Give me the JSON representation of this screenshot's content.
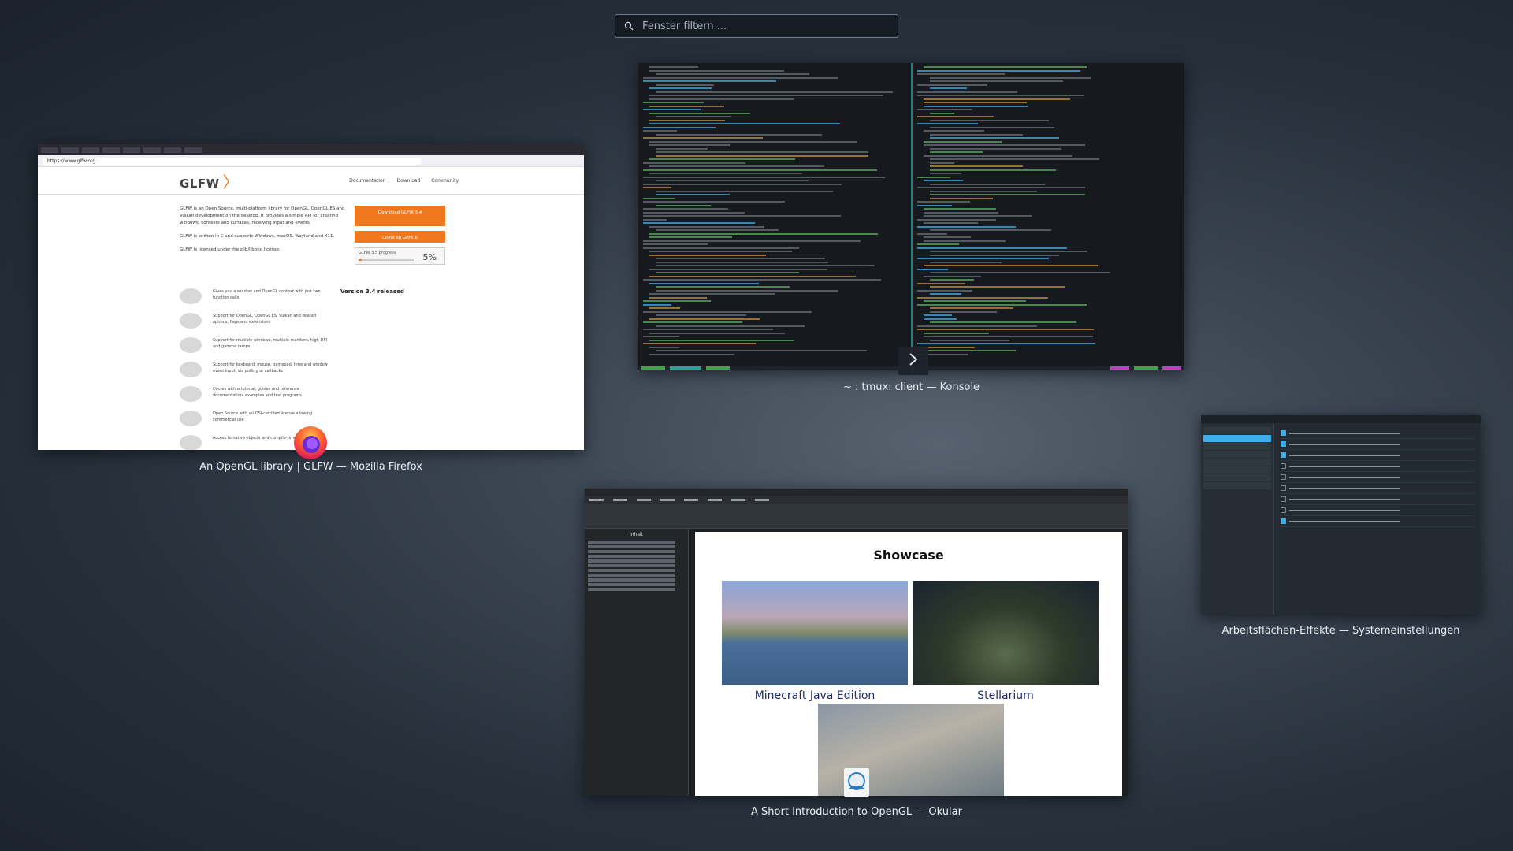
{
  "search": {
    "placeholder": "Fenster filtern ..."
  },
  "windows": {
    "firefox": {
      "caption": "An OpenGL library | GLFW — Mozilla Firefox",
      "page": {
        "url": "https://www.glfw.org",
        "logo": "GLFW",
        "nav": [
          "Documentation",
          "Download",
          "Community"
        ],
        "intro": [
          "GLFW is an Open Source, multi-platform library for OpenGL, OpenGL ES and Vulkan development on the desktop. It provides a simple API for creating windows, contexts and surfaces, receiving input and events.",
          "GLFW is written in C and supports Windows, macOS, Wayland and X11.",
          "GLFW is licensed under the zlib/libpng license."
        ],
        "download_button": "Download GLFW 3.4",
        "github_button": "Clone on GitHub",
        "progress_label": "GLFW 3.5 progress",
        "progress_text": "5%",
        "progress_value": 0.05,
        "features": [
          "Gives you a window and OpenGL context with just two function calls",
          "Support for OpenGL, OpenGL ES, Vulkan and related options, flags and extensions",
          "Support for multiple windows, multiple monitors, high-DPI and gamma ramps",
          "Support for keyboard, mouse, gamepad, time and window event input, via polling or callbacks",
          "Comes with a tutorial, guides and reference documentation, examples and test programs",
          "Open Source with an OSI-certified license allowing commercial use",
          "Access to native objects and compile-time options for"
        ],
        "news_title": "Version 3.4 released"
      }
    },
    "konsole": {
      "caption": "~ : tmux: client — Konsole"
    },
    "settings": {
      "caption": "Arbeitsflächen-Effekte — Systemeinstellungen"
    },
    "okular": {
      "caption": "A Short Introduction to OpenGL — Okular",
      "sidebar_title": "Inhalt",
      "page_title": "Showcase",
      "images": [
        "Minecraft Java Edition",
        "Stellarium"
      ]
    }
  },
  "colors": {
    "accent": "#3daee9",
    "glfw_orange": "#f0791f"
  }
}
